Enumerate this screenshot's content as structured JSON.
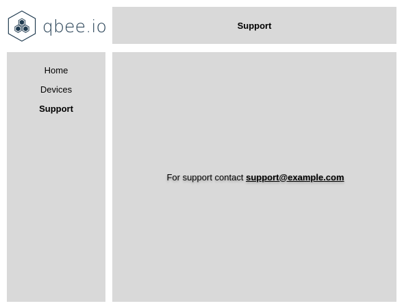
{
  "logo": {
    "text": "qbee.io",
    "icon": "hexagon-honeycomb-icon",
    "color": "#1f3a4f"
  },
  "header": {
    "title": "Support"
  },
  "sidebar": {
    "items": [
      {
        "label": "Home",
        "active": false
      },
      {
        "label": "Devices",
        "active": false
      },
      {
        "label": "Support",
        "active": true
      }
    ]
  },
  "main": {
    "support_text": "For support contact",
    "support_email": "support@example.com"
  },
  "colors": {
    "panel_bg": "#d9d9d9",
    "page_bg": "#ffffff",
    "text": "#000000"
  }
}
